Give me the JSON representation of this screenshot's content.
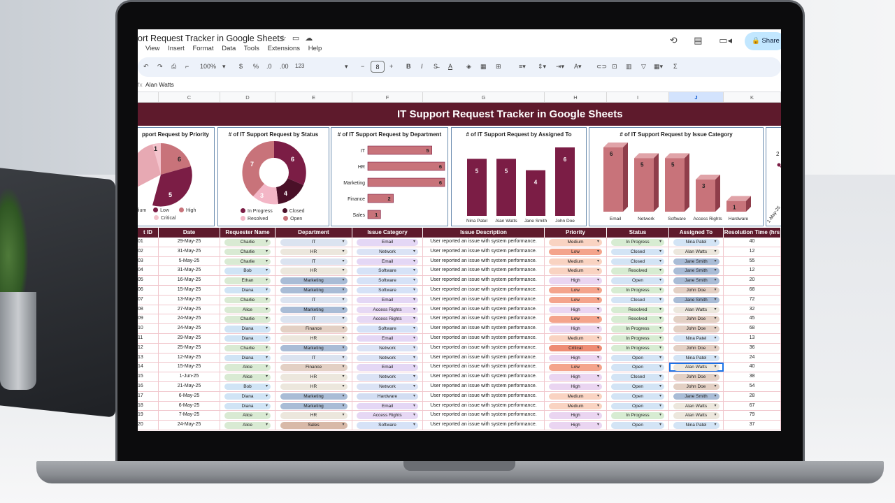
{
  "sheet": {
    "doc_title": "ort Request Tracker in Google Sheets",
    "menu": [
      "View",
      "Insert",
      "Format",
      "Data",
      "Tools",
      "Extensions",
      "Help"
    ],
    "share_label": "Share",
    "zoom": "100%",
    "font_size": "8",
    "formula_value": "Alan Watts",
    "fx_label": "fx",
    "toolbar_symbols": {
      "currency": "$",
      "percent": "%",
      "dec_decrease": ".0",
      "dec_increase": ".00",
      "number_format": "123",
      "bold": "B",
      "italic": "I",
      "sum": "Σ"
    },
    "columns": [
      "C",
      "D",
      "E",
      "F",
      "G",
      "H",
      "I",
      "J",
      "K"
    ]
  },
  "dashboard_title": "IT Support Request Tracker in Google Sheets",
  "charts": {
    "priority": {
      "title": "pport Request by Priority",
      "labels": [
        "1",
        "6",
        "5"
      ],
      "legend": [
        "dium",
        "Low",
        "High",
        "Critical"
      ],
      "colors": [
        "#e7a9b3",
        "#7b1d45",
        "#c8737a",
        "#f3c3cc"
      ]
    },
    "status": {
      "title": "# of IT Support Request by Status",
      "labels": [
        "6",
        "7",
        "4",
        "3"
      ],
      "legend": [
        "In Progress",
        "Closed",
        "Resolved",
        "Open"
      ],
      "colors": [
        "#7b1d45",
        "#4a1028",
        "#f3b6c6",
        "#c8737a"
      ]
    },
    "department": {
      "title": "# of IT Support Request by Department",
      "categories": [
        "IT",
        "HR",
        "Marketing",
        "Finance",
        "Sales"
      ],
      "values": [
        5,
        6,
        6,
        2,
        1
      ],
      "color": "#c8737a"
    },
    "assigned": {
      "title": "# of IT Support Request by Assigned To",
      "categories": [
        "Nina Patel",
        "Alan Watts",
        "Jane Smith",
        "John Doe"
      ],
      "values": [
        5,
        5,
        4,
        6
      ],
      "color": "#7b1d45"
    },
    "category": {
      "title": "# of IT Support Request by Issue Category",
      "categories": [
        "Email",
        "Network",
        "Software",
        "Access Rights",
        "Hardware"
      ],
      "values": [
        6,
        5,
        5,
        3,
        1
      ],
      "color": "#c8737a"
    },
    "partial": {
      "label": "2",
      "date_label": "1-May-25"
    }
  },
  "table": {
    "headers": [
      "t ID",
      "Date",
      "Requester Name",
      "Department",
      "Issue Category",
      "Issue Description",
      "Priority",
      "Status",
      "Assigned To",
      "Resolution Time (hrs"
    ],
    "rows": [
      [
        "01",
        "29-May-25",
        "Charlie",
        "IT",
        "Email",
        "User reported an issue with system performance.",
        "Medium",
        "In Progress",
        "Nina Patel",
        "40"
      ],
      [
        "02",
        "31-May-25",
        "Charlie",
        "HR",
        "Network",
        "User reported an issue with system performance.",
        "Low",
        "Closed",
        "Alan Watts",
        "12"
      ],
      [
        "03",
        "5-May-25",
        "Charlie",
        "IT",
        "Email",
        "User reported an issue with system performance.",
        "Medium",
        "Closed",
        "Jane Smith",
        "55"
      ],
      [
        "04",
        "31-May-25",
        "Bob",
        "HR",
        "Software",
        "User reported an issue with system performance.",
        "Medium",
        "Resolved",
        "Jane Smith",
        "12"
      ],
      [
        "05",
        "16-May-25",
        "Ethan",
        "Marketing",
        "Software",
        "User reported an issue with system performance.",
        "High",
        "Open",
        "Jane Smith",
        "20"
      ],
      [
        "06",
        "15-May-25",
        "Diana",
        "Marketing",
        "Software",
        "User reported an issue with system performance.",
        "Low",
        "In Progress",
        "John Doe",
        "68"
      ],
      [
        "07",
        "13-May-25",
        "Charlie",
        "IT",
        "Email",
        "User reported an issue with system performance.",
        "Low",
        "Closed",
        "Jane Smith",
        "72"
      ],
      [
        "08",
        "27-May-25",
        "Alice",
        "Marketing",
        "Access Rights",
        "User reported an issue with system performance.",
        "High",
        "Resolved",
        "Alan Watts",
        "32"
      ],
      [
        "09",
        "24-May-25",
        "Charlie",
        "IT",
        "Access Rights",
        "User reported an issue with system performance.",
        "Low",
        "Resolved",
        "John Doe",
        "45"
      ],
      [
        "10",
        "24-May-25",
        "Diana",
        "Finance",
        "Software",
        "User reported an issue with system performance.",
        "High",
        "In Progress",
        "John Doe",
        "68"
      ],
      [
        "11",
        "29-May-25",
        "Diana",
        "HR",
        "Email",
        "User reported an issue with system performance.",
        "Medium",
        "In Progress",
        "Nina Patel",
        "13"
      ],
      [
        "12",
        "25-May-25",
        "Charlie",
        "Marketing",
        "Network",
        "User reported an issue with system performance.",
        "Critical",
        "In Progress",
        "John Doe",
        "36"
      ],
      [
        "13",
        "12-May-25",
        "Diana",
        "IT",
        "Network",
        "User reported an issue with system performance.",
        "High",
        "Open",
        "Nina Patel",
        "24"
      ],
      [
        "14",
        "15-May-25",
        "Alice",
        "Finance",
        "Email",
        "User reported an issue with system performance.",
        "Low",
        "Open",
        "Alan Watts",
        "40"
      ],
      [
        "15",
        "1-Jun-25",
        "Alice",
        "HR",
        "Network",
        "User reported an issue with system performance.",
        "High",
        "Closed",
        "John Doe",
        "38"
      ],
      [
        "16",
        "21-May-25",
        "Bob",
        "HR",
        "Network",
        "User reported an issue with system performance.",
        "High",
        "Open",
        "John Doe",
        "54"
      ],
      [
        "17",
        "6-May-25",
        "Diana",
        "Marketing",
        "Hardware",
        "User reported an issue with system performance.",
        "Medium",
        "Open",
        "Jane Smith",
        "28"
      ],
      [
        "18",
        "6-May-25",
        "Diana",
        "Marketing",
        "Email",
        "User reported an issue with system performance.",
        "Medium",
        "Open",
        "Alan Watts",
        "67"
      ],
      [
        "19",
        "7-May-25",
        "Alice",
        "HR",
        "Access Rights",
        "User reported an issue with system performance.",
        "High",
        "In Progress",
        "Alan Watts",
        "79"
      ],
      [
        "20",
        "24-May-25",
        "Alice",
        "Sales",
        "Software",
        "User reported an issue with system performance.",
        "High",
        "Open",
        "Nina Patel",
        "37"
      ]
    ],
    "chip_colors": {
      "requester": {
        "Charlie": "#d9ead3",
        "Bob": "#d0e4f5",
        "Ethan": "#d9ead3",
        "Diana": "#d0e4f5",
        "Alice": "#d9ead3"
      },
      "department": {
        "IT": "#dbe3f0",
        "HR": "#ece7dd",
        "Marketing": "#a9bcd6",
        "Finance": "#e3d0c4",
        "Sales": "#d8b9a8"
      },
      "category": {
        "Email": "#e4d7f5",
        "Network": "#dbe3f5",
        "Software": "#d6e2f7",
        "Access Rights": "#e6d8f4",
        "Hardware": "#d2ddf2"
      },
      "priority": {
        "Medium": "#f9d3c2",
        "Low": "#f4a48c",
        "High": "#ead5f1",
        "Critical": "#ee8c74"
      },
      "status": {
        "In Progress": "#d7ecd2",
        "Closed": "#d3e4f5",
        "Resolved": "#d7ecd2",
        "Open": "#d3e4f5"
      },
      "assigned": {
        "Nina Patel": "#d3e4f5",
        "Alan Watts": "#ece7dd",
        "Jane Smith": "#a9bcd6",
        "John Doe": "#e3d0c4"
      }
    }
  }
}
